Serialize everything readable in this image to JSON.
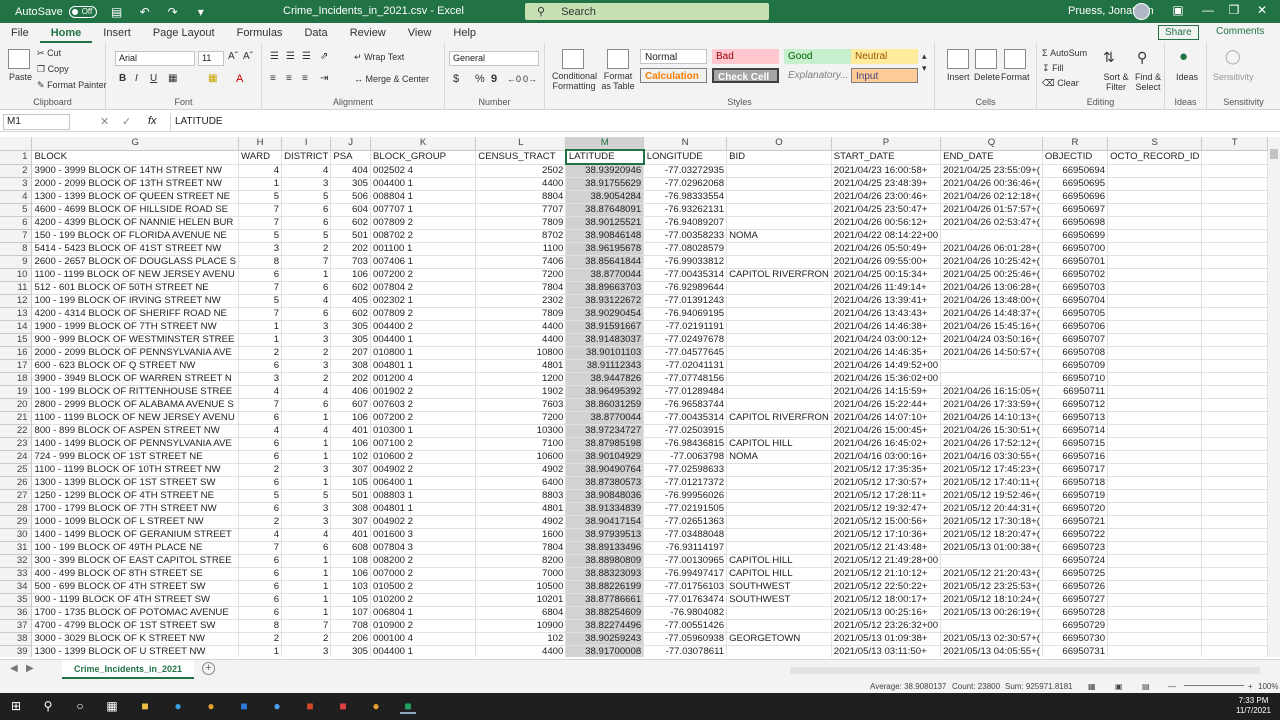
{
  "titlebar": {
    "autosave_label": "AutoSave",
    "autosave_state": "Off",
    "document_title": "Crime_Incidents_in_2021.csv  -  Excel",
    "search_placeholder": "Search",
    "user_name": "Pruess, Jonathan"
  },
  "tabs": [
    "File",
    "Home",
    "Insert",
    "Page Layout",
    "Formulas",
    "Data",
    "Review",
    "View",
    "Help"
  ],
  "active_tab": "Home",
  "share_label": "Share",
  "comments_label": "Comments",
  "ribbon": {
    "clipboard": {
      "label": "Clipboard",
      "paste": "Paste",
      "cut": "Cut",
      "copy": "Copy",
      "format_painter": "Format Painter"
    },
    "font": {
      "label": "Font",
      "name": "Arial",
      "size": "11",
      "bold": "B",
      "italic": "I",
      "underline": "U"
    },
    "alignment": {
      "label": "Alignment",
      "wrap_text": "Wrap Text",
      "merge_center": "Merge & Center"
    },
    "number": {
      "label": "Number",
      "format": "General",
      "currency": "$",
      "percent": "%",
      "comma": "9"
    },
    "styles": {
      "label": "Styles",
      "conditional": "Conditional Formatting",
      "format_table": "Format as Table",
      "normal": "Normal",
      "bad": "Bad",
      "good": "Good",
      "neutral": "Neutral",
      "calculation": "Calculation",
      "check_cell": "Check Cell",
      "explanatory": "Explanatory...",
      "input": "Input"
    },
    "cells": {
      "label": "Cells",
      "insert": "Insert",
      "delete": "Delete",
      "format": "Format"
    },
    "editing": {
      "label": "Editing",
      "autosum": "AutoSum",
      "fill": "Fill",
      "clear": "Clear",
      "sort_filter": "Sort & Filter",
      "find_select": "Find & Select"
    },
    "ideas": {
      "label": "Ideas",
      "ideas": "Ideas"
    },
    "sensitivity": {
      "label": "Sensitivity",
      "sensitivity": "Sensitivity"
    }
  },
  "formula_bar": {
    "name_box": "M1",
    "formula": "LATITUDE"
  },
  "grid": {
    "columns": [
      "G",
      "H",
      "I",
      "J",
      "K",
      "L",
      "M",
      "N",
      "O",
      "P",
      "Q",
      "R",
      "S",
      "T"
    ],
    "selected_column": "M",
    "rows": [
      {
        "n": "1",
        "c": [
          "BLOCK",
          "WARD",
          "DISTRICT",
          "PSA",
          "BLOCK_GROUP",
          "CENSUS_TRACT",
          "LATITUDE",
          "LONGITUDE",
          "BID",
          "START_DATE",
          "END_DATE",
          "OBJECTID",
          "OCTO_RECORD_ID",
          ""
        ]
      },
      {
        "n": "2",
        "c": [
          "3900 - 3999 BLOCK OF 14TH STREET NW",
          "4",
          "4",
          "404",
          "002502 4",
          "2502",
          "38.93920946",
          "-77.03272935",
          "",
          "2021/04/23 16:00:58+",
          "2021/04/25 23:55:09+(",
          "66950694",
          "",
          ""
        ]
      },
      {
        "n": "3",
        "c": [
          "2000 - 2099 BLOCK OF 13TH STREET NW",
          "1",
          "3",
          "305",
          "004400 1",
          "4400",
          "38.91755629",
          "-77.02962068",
          "",
          "2021/04/25 23:48:39+",
          "2021/04/26 00:36:46+(",
          "66950695",
          "",
          ""
        ]
      },
      {
        "n": "4",
        "c": [
          "1300 - 1399 BLOCK OF QUEEN STREET NE",
          "5",
          "5",
          "506",
          "008804 1",
          "8804",
          "38.9054284",
          "-76.98333554",
          "",
          "2021/04/26 23:00:46+",
          "2021/04/26 02:12:18+(",
          "66950696",
          "",
          ""
        ]
      },
      {
        "n": "5",
        "c": [
          "4600 - 4699 BLOCK OF HILLSIDE ROAD SE",
          "7",
          "6",
          "604",
          "007707 1",
          "7707",
          "38.87648091",
          "-76.93262131",
          "",
          "2021/04/25 23:50:47+",
          "2021/04/26 01:57:57+(",
          "66950697",
          "",
          ""
        ]
      },
      {
        "n": "6",
        "c": [
          "4200 - 4399 BLOCK OF NANNIE HELEN BUR",
          "7",
          "6",
          "602",
          "007809 2",
          "7809",
          "38.90125521",
          "-76.94089207",
          "",
          "2021/04/26 00:56:12+",
          "2021/04/26 02:53:47+(",
          "66950698",
          "",
          ""
        ]
      },
      {
        "n": "7",
        "c": [
          "150 - 199 BLOCK OF FLORIDA AVENUE NE",
          "5",
          "5",
          "501",
          "008702 2",
          "8702",
          "38.90846148",
          "-77.00358233",
          "NOMA",
          "2021/04/22 08:14:22+00",
          "",
          "66950699",
          "",
          ""
        ]
      },
      {
        "n": "8",
        "c": [
          "5414 - 5423 BLOCK OF 41ST STREET NW",
          "3",
          "2",
          "202",
          "001100 1",
          "1100",
          "38.96195678",
          "-77.08028579",
          "",
          "2021/04/26 05:50:49+",
          "2021/04/26 06:01:28+(",
          "66950700",
          "",
          ""
        ]
      },
      {
        "n": "9",
        "c": [
          "2600 - 2657 BLOCK OF DOUGLASS PLACE S",
          "8",
          "7",
          "703",
          "007406 1",
          "7406",
          "38.85641844",
          "-76.99033812",
          "",
          "2021/04/26 09:55:00+",
          "2021/04/26 10:25:42+(",
          "66950701",
          "",
          ""
        ]
      },
      {
        "n": "10",
        "c": [
          "1100 - 1199 BLOCK OF NEW JERSEY AVENU",
          "6",
          "1",
          "106",
          "007200 2",
          "7200",
          "38.8770044",
          "-77.00435314",
          "CAPITOL RIVERFRON",
          "2021/04/25 00:15:34+",
          "2021/04/25 00:25:46+(",
          "66950702",
          "",
          ""
        ]
      },
      {
        "n": "11",
        "c": [
          "512 - 601 BLOCK OF 50TH STREET NE",
          "7",
          "6",
          "602",
          "007804 2",
          "7804",
          "38.89663703",
          "-76.92989644",
          "",
          "2021/04/26 11:49:14+",
          "2021/04/26 13:06:28+(",
          "66950703",
          "",
          ""
        ]
      },
      {
        "n": "12",
        "c": [
          "100 - 199 BLOCK OF IRVING STREET NW",
          "5",
          "4",
          "405",
          "002302 1",
          "2302",
          "38.93122672",
          "-77.01391243",
          "",
          "2021/04/26 13:39:41+",
          "2021/04/26 13:48:00+(",
          "66950704",
          "",
          ""
        ]
      },
      {
        "n": "13",
        "c": [
          "4200 - 4314 BLOCK OF SHERIFF ROAD NE",
          "7",
          "6",
          "602",
          "007809 2",
          "7809",
          "38.90290454",
          "-76.94069195",
          "",
          "2021/04/26 13:43:43+",
          "2021/04/26 14:48:37+(",
          "66950705",
          "",
          ""
        ]
      },
      {
        "n": "14",
        "c": [
          "1900 - 1999 BLOCK OF 7TH STREET NW",
          "1",
          "3",
          "305",
          "004400 2",
          "4400",
          "38.91591667",
          "-77.02191191",
          "",
          "2021/04/26 14:46:38+",
          "2021/04/26 15:45:16+(",
          "66950706",
          "",
          ""
        ]
      },
      {
        "n": "15",
        "c": [
          "900 - 999 BLOCK OF WESTMINSTER STREE",
          "1",
          "3",
          "305",
          "004400 1",
          "4400",
          "38.91483037",
          "-77.02497678",
          "",
          "2021/04/24 03:00:12+",
          "2021/04/24 03:50:16+(",
          "66950707",
          "",
          ""
        ]
      },
      {
        "n": "16",
        "c": [
          "2000 - 2099 BLOCK OF PENNSYLVANIA AVE",
          "2",
          "2",
          "207",
          "010800 1",
          "10800",
          "38.90101103",
          "-77.04577645",
          "",
          "2021/04/26 14:46:35+",
          "2021/04/26 14:50:57+(",
          "66950708",
          "",
          ""
        ]
      },
      {
        "n": "17",
        "c": [
          "600 - 623 BLOCK OF Q STREET NW",
          "6",
          "3",
          "308",
          "004801 1",
          "4801",
          "38.91112343",
          "-77.02041131",
          "",
          "2021/04/26 14:49:52+00",
          "",
          "66950709",
          "",
          ""
        ]
      },
      {
        "n": "18",
        "c": [
          "3900 - 3949 BLOCK OF WARREN STREET N",
          "3",
          "2",
          "202",
          "001200 4",
          "1200",
          "38.9447826",
          "-77.07748156",
          "",
          "2021/04/26 15:36:02+00",
          "",
          "66950710",
          "",
          ""
        ]
      },
      {
        "n": "19",
        "c": [
          "100 - 199 BLOCK OF RITTENHOUSE STREE",
          "4",
          "4",
          "406",
          "001902 2",
          "1902",
          "38.96495392",
          "-77.01289484",
          "",
          "2021/04/26 14:15:59+",
          "2021/04/26 16:15:05+(",
          "66950711",
          "",
          ""
        ]
      },
      {
        "n": "20",
        "c": [
          "2800 - 2999 BLOCK OF ALABAMA AVENUE S",
          "7",
          "6",
          "607",
          "007603 2",
          "7603",
          "38.86031259",
          "-76.96583744",
          "",
          "2021/04/26 15:22:44+",
          "2021/04/26 17:33:59+(",
          "66950712",
          "",
          ""
        ]
      },
      {
        "n": "21",
        "c": [
          "1100 - 1199 BLOCK OF NEW JERSEY AVENU",
          "6",
          "1",
          "106",
          "007200 2",
          "7200",
          "38.8770044",
          "-77.00435314",
          "CAPITOL RIVERFRON",
          "2021/04/26 14:07:10+",
          "2021/04/26 14:10:13+(",
          "66950713",
          "",
          ""
        ]
      },
      {
        "n": "22",
        "c": [
          "800 - 899 BLOCK OF ASPEN STREET NW",
          "4",
          "4",
          "401",
          "010300 1",
          "10300",
          "38.97234727",
          "-77.02503915",
          "",
          "2021/04/26 15:00:45+",
          "2021/04/26 15:30:51+(",
          "66950714",
          "",
          ""
        ]
      },
      {
        "n": "23",
        "c": [
          "1400 - 1499 BLOCK OF PENNSYLVANIA AVE",
          "6",
          "1",
          "106",
          "007100 2",
          "7100",
          "38.87985198",
          "-76.98436815",
          "CAPITOL HILL",
          "2021/04/26 16:45:02+",
          "2021/04/26 17:52:12+(",
          "66950715",
          "",
          ""
        ]
      },
      {
        "n": "24",
        "c": [
          "724 - 999 BLOCK OF 1ST STREET NE",
          "6",
          "1",
          "102",
          "010600 2",
          "10600",
          "38.90104929",
          "-77.0063798",
          "NOMA",
          "2021/04/16 03:00:16+",
          "2021/04/16 03:30:55+(",
          "66950716",
          "",
          ""
        ]
      },
      {
        "n": "25",
        "c": [
          "1100 - 1199 BLOCK OF 10TH STREET NW",
          "2",
          "3",
          "307",
          "004902 2",
          "4902",
          "38.90490764",
          "-77.02598633",
          "",
          "2021/05/12 17:35:35+",
          "2021/05/12 17:45:23+(",
          "66950717",
          "",
          ""
        ]
      },
      {
        "n": "26",
        "c": [
          "1300 - 1399 BLOCK OF 1ST STREET SW",
          "6",
          "1",
          "105",
          "006400 1",
          "6400",
          "38.87380573",
          "-77.01217372",
          "",
          "2021/05/12 17:30:57+",
          "2021/05/12 17:40:11+(",
          "66950718",
          "",
          ""
        ]
      },
      {
        "n": "27",
        "c": [
          "1250 - 1299 BLOCK OF 4TH STREET NE",
          "5",
          "5",
          "501",
          "008803 1",
          "8803",
          "38.90848036",
          "-76.99956026",
          "",
          "2021/05/12 17:28:11+",
          "2021/05/12 19:52:46+(",
          "66950719",
          "",
          ""
        ]
      },
      {
        "n": "28",
        "c": [
          "1700 - 1799 BLOCK OF 7TH STREET NW",
          "6",
          "3",
          "308",
          "004801 1",
          "4801",
          "38.91334839",
          "-77.02191505",
          "",
          "2021/05/12 19:32:47+",
          "2021/05/12 20:44:31+(",
          "66950720",
          "",
          ""
        ]
      },
      {
        "n": "29",
        "c": [
          "1000 - 1099 BLOCK OF L STREET NW",
          "2",
          "3",
          "307",
          "004902 2",
          "4902",
          "38.90417154",
          "-77.02651363",
          "",
          "2021/05/12 15:00:56+",
          "2021/05/12 17:30:18+(",
          "66950721",
          "",
          ""
        ]
      },
      {
        "n": "30",
        "c": [
          "1400 - 1499 BLOCK OF GERANIUM STREET",
          "4",
          "4",
          "401",
          "001600 3",
          "1600",
          "38.97939513",
          "-77.03488048",
          "",
          "2021/05/12 17:10:36+",
          "2021/05/12 18:20:47+(",
          "66950722",
          "",
          ""
        ]
      },
      {
        "n": "31",
        "c": [
          "100 - 199 BLOCK OF 49TH PLACE NE",
          "7",
          "6",
          "608",
          "007804 3",
          "7804",
          "38.89133496",
          "-76.93114197",
          "",
          "2021/05/12 21:43:48+",
          "2021/05/13 01:00:38+(",
          "66950723",
          "",
          ""
        ]
      },
      {
        "n": "32",
        "c": [
          "300 - 399 BLOCK OF EAST CAPITOL STREE",
          "6",
          "1",
          "108",
          "008200 2",
          "8200",
          "38.88980809",
          "-77.00130965",
          "CAPITOL HILL",
          "2021/05/12 21:49:28+00",
          "",
          "66950724",
          "",
          ""
        ]
      },
      {
        "n": "33",
        "c": [
          "400 - 499 BLOCK OF 8TH STREET SE",
          "6",
          "1",
          "106",
          "007000 2",
          "7000",
          "38.88323093",
          "-76.99497417",
          "CAPITOL HILL",
          "2021/05/12 21:10:12+",
          "2021/05/12 21:20:43+(",
          "66950725",
          "",
          ""
        ]
      },
      {
        "n": "34",
        "c": [
          "500 - 699 BLOCK OF 4TH STREET SW",
          "6",
          "1",
          "103",
          "010500 2",
          "10500",
          "38.88226199",
          "-77.01756103",
          "SOUTHWEST",
          "2021/05/12 22:50:22+",
          "2021/05/12 23:25:53+(",
          "66950726",
          "",
          ""
        ]
      },
      {
        "n": "35",
        "c": [
          "900 - 1199 BLOCK OF 4TH STREET SW",
          "6",
          "1",
          "105",
          "010200 2",
          "10201",
          "38.87786661",
          "-77.01763474",
          "SOUTHWEST",
          "2021/05/12 18:00:17+",
          "2021/05/12 18:10:24+(",
          "66950727",
          "",
          ""
        ]
      },
      {
        "n": "36",
        "c": [
          "1700 - 1735 BLOCK OF POTOMAC AVENUE",
          "6",
          "1",
          "107",
          "006804 1",
          "6804",
          "38.88254609",
          "-76.9804082",
          "",
          "2021/05/13 00:25:16+",
          "2021/05/13 00:26:19+(",
          "66950728",
          "",
          ""
        ]
      },
      {
        "n": "37",
        "c": [
          "4700 - 4799 BLOCK OF 1ST STREET SW",
          "8",
          "7",
          "708",
          "010900 2",
          "10900",
          "38.82274496",
          "-77.00551426",
          "",
          "2021/05/12 23:26:32+00",
          "",
          "66950729",
          "",
          ""
        ]
      },
      {
        "n": "38",
        "c": [
          "3000 - 3029 BLOCK OF K STREET NW",
          "2",
          "2",
          "206",
          "000100 4",
          "102",
          "38.90259243",
          "-77.05960938",
          "GEORGETOWN",
          "2021/05/13 01:09:38+",
          "2021/05/13 02:30:57+(",
          "66950730",
          "",
          ""
        ]
      },
      {
        "n": "39",
        "c": [
          "1300 - 1399 BLOCK OF U STREET NW",
          "1",
          "3",
          "305",
          "004400 1",
          "4400",
          "38.91700008",
          "-77.03078611",
          "",
          "2021/05/13 03:11:50+",
          "2021/05/13 04:05:55+(",
          "66950731",
          "",
          ""
        ]
      },
      {
        "n": "40",
        "c": [
          "600 - 699 BLOCK OF H STREET NW",
          "2",
          "1",
          "101",
          "005800 2",
          "5800",
          "38.89981191",
          "-77.0209122",
          "DOWNTOWN",
          "2021/05/13 06:17:18+",
          "2021/05/13 07:30:14+(",
          "66950732",
          "",
          ""
        ]
      }
    ]
  },
  "sheet_tab": "Crime_Incidents_in_2021",
  "status": {
    "average": "Average: 38.9080137",
    "count": "Count: 23800",
    "sum": "Sum: 925971.8181",
    "zoom": "100%"
  },
  "clock": {
    "time": "7:33 PM",
    "date": "11/7/2021"
  }
}
